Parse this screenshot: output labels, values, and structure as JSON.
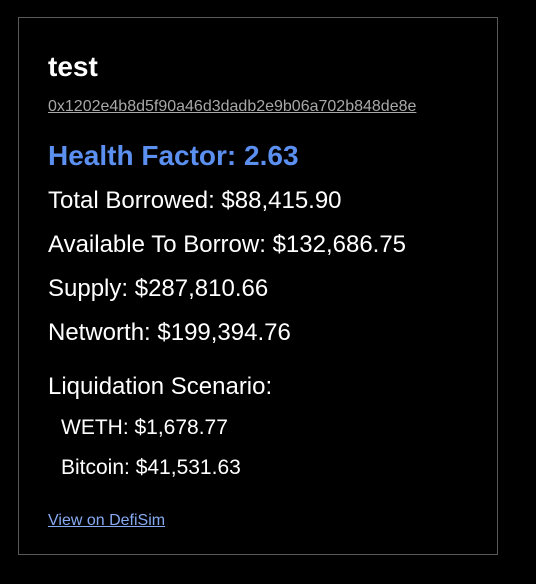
{
  "account": {
    "name": "test",
    "address": "0x1202e4b8d5f90a46d3dadb2e9b06a702b848de8e"
  },
  "health_factor": {
    "label": "Health Factor:",
    "value": "2.63",
    "text": "Health Factor: 2.63"
  },
  "stats": {
    "total_borrowed": "Total Borrowed: $88,415.90",
    "available_to_borrow": "Available To Borrow: $132,686.75",
    "supply": "Supply: $287,810.66",
    "networth": "Networth: $199,394.76"
  },
  "liquidation": {
    "title": "Liquidation Scenario:",
    "items": [
      {
        "text": "WETH: $1,678.77"
      },
      {
        "text": "Bitcoin: $41,531.63"
      }
    ]
  },
  "links": {
    "defisim": "View on DefiSim"
  },
  "colors": {
    "background": "#000000",
    "border": "#5a5a5a",
    "health_factor": "#5b8ff0",
    "link": "#86aaf2",
    "address": "#a8a8a8"
  }
}
